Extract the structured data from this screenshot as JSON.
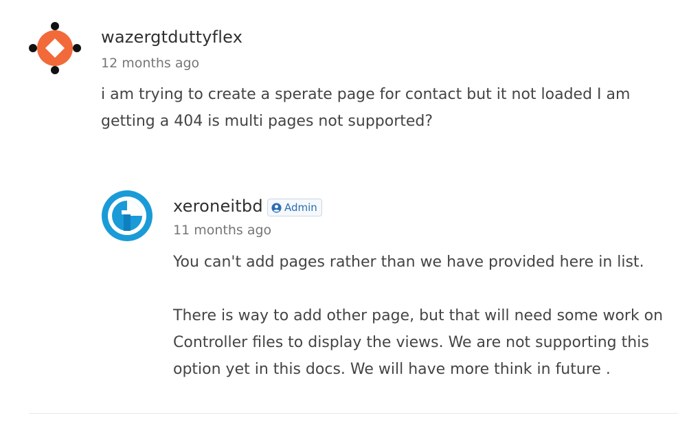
{
  "comments": [
    {
      "author": "wazergtduttyflex",
      "time": "12 months ago",
      "avatar_icon": "orange-network-logo-icon",
      "paragraphs": [
        "i am trying to create a sperate page for contact but it not loaded I am getting a 404 is multi pages not supported?"
      ]
    }
  ],
  "replies": [
    {
      "author": "xeroneitbd",
      "badge": "Admin",
      "badge_icon": "user-circle-icon",
      "time": "11 months ago",
      "avatar_icon": "blue-circle-logo-icon",
      "paragraphs": [
        "You can't add pages rather than we have provided here in list.",
        "There is way to add other page, but that will need some work on Controller files to display the views. We are not supporting this option yet in this docs. We will have more think in future ."
      ]
    }
  ],
  "colors": {
    "orange": "#f26a3a",
    "blue": "#1a9bd7",
    "badge_text": "#2b6cb0"
  }
}
